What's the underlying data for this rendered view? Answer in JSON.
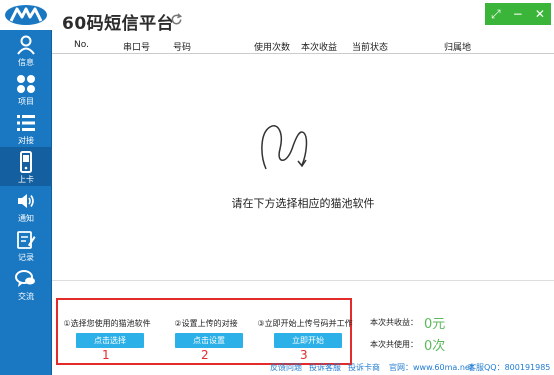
{
  "app": {
    "title": "60码短信平台"
  },
  "sidebar": {
    "items": [
      {
        "label": "信息",
        "icon": "user-icon"
      },
      {
        "label": "项目",
        "icon": "grid-icon"
      },
      {
        "label": "对接",
        "icon": "list-icon"
      },
      {
        "label": "上卡",
        "icon": "phone-icon"
      },
      {
        "label": "通知",
        "icon": "speaker-icon"
      },
      {
        "label": "记录",
        "icon": "note-icon"
      },
      {
        "label": "交流",
        "icon": "chat-icon"
      }
    ]
  },
  "table": {
    "columns": [
      "No.",
      "串口号",
      "号码",
      "使用次数",
      "本次收益",
      "当前状态",
      "归属地"
    ]
  },
  "empty_state": {
    "message": "请在下方选择相应的猫池软件"
  },
  "steps": [
    {
      "label": "①选择您使用的猫池软件",
      "button": "点击选择",
      "number": "1"
    },
    {
      "label": "②设置上传的对接",
      "button": "点击设置",
      "number": "2"
    },
    {
      "label": "③立即开始上传号码并工作",
      "button": "立即开始",
      "number": "3"
    }
  ],
  "stats": {
    "income_label": "本次共收益：",
    "income_value": "0元",
    "usage_label": "本次共使用：",
    "usage_value": "0次"
  },
  "footer": {
    "feedback": "反馈问题",
    "complaint_support": "投诉客服",
    "complaint_merchant": "投诉卡商",
    "website": "官网：www.60ma.net",
    "qq": "客服QQ：800191985"
  },
  "colors": {
    "sidebar": "#1a78c2",
    "accent_button": "#2bb0e7",
    "highlight": "#e32b2b",
    "stat_value": "#5cb85c",
    "window_controls": "#3ab53a"
  }
}
